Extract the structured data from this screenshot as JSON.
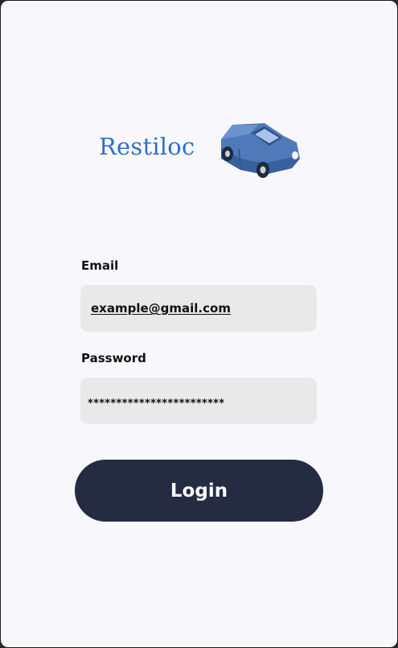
{
  "brand": {
    "name": "Restiloc",
    "logo_icon": "car-icon",
    "color": "#2f6fc8"
  },
  "form": {
    "email_label": "Email",
    "email_value": "example@gmail.com",
    "password_label": "Password",
    "password_value": "************************",
    "login_label": "Login"
  },
  "colors": {
    "background": "#f8f8fc",
    "field_background": "#e9e9e9",
    "button_background": "#252b40",
    "button_text": "#ffffff"
  }
}
